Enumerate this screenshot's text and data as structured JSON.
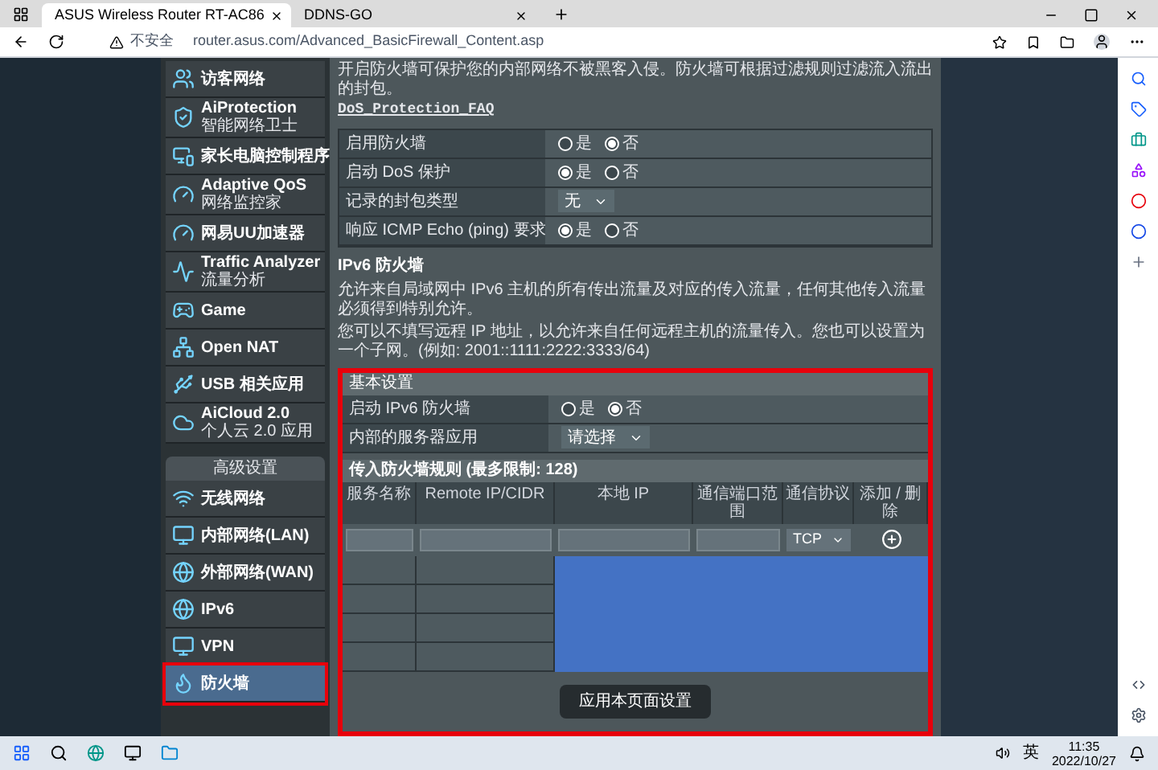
{
  "browser": {
    "tabs": [
      {
        "title": "ASUS Wireless Router RT-AC86",
        "selected": true
      },
      {
        "title": "DDNS-GO",
        "selected": false
      }
    ],
    "address": {
      "security_label": "不安全",
      "url": "router.asus.com/Advanced_BasicFirewall_Content.asp"
    }
  },
  "sidebar": {
    "general_items": [
      {
        "title": "访客网络",
        "selected": false
      },
      {
        "title": "AiProtection",
        "subtitle": "智能网络卫士",
        "selected": false
      },
      {
        "title": "家长电脑控制程序",
        "selected": false
      },
      {
        "title": "Adaptive QoS",
        "subtitle": "网络监控家",
        "selected": false
      },
      {
        "title": "网易UU加速器",
        "selected": false
      },
      {
        "title": "Traffic Analyzer",
        "subtitle": "流量分析",
        "selected": false
      },
      {
        "title": "Game",
        "selected": false
      },
      {
        "title": "Open NAT",
        "selected": false
      },
      {
        "title": "USB 相关应用",
        "selected": false
      },
      {
        "title": "AiCloud 2.0",
        "subtitle": "个人云 2.0 应用",
        "selected": false
      }
    ],
    "advanced_header": "高级设置",
    "advanced_items": [
      {
        "title": "无线网络",
        "selected": false
      },
      {
        "title": "内部网络(LAN)",
        "selected": false
      },
      {
        "title": "外部网络(WAN)",
        "selected": false
      },
      {
        "title": "IPv6",
        "selected": false
      },
      {
        "title": "VPN",
        "selected": false
      },
      {
        "title": "防火墙",
        "selected": true
      }
    ]
  },
  "main": {
    "intro": "开启防火墙可保护您的内部网络不被黑客入侵。防火墙可根据过滤规则过滤流入流出的封包。",
    "faq_link": "DoS_Protection_FAQ",
    "settings": [
      {
        "kind": "radio",
        "label": "启用防火墙",
        "options": [
          {
            "label": "是",
            "selected": false
          },
          {
            "label": "否",
            "selected": true
          }
        ]
      },
      {
        "kind": "radio",
        "label": "启动 DoS 保护",
        "options": [
          {
            "label": "是",
            "selected": true
          },
          {
            "label": "否",
            "selected": false
          }
        ]
      },
      {
        "kind": "select",
        "label": "记录的封包类型",
        "value": "无"
      },
      {
        "kind": "radio",
        "label": "响应 ICMP Echo (ping) 要求",
        "options": [
          {
            "label": "是",
            "selected": true
          },
          {
            "label": "否",
            "selected": false
          }
        ]
      }
    ],
    "ipv6_heading": "IPv6 防火墙",
    "ipv6_paragraphs": [
      "允许来自局域网中 IPv6 主机的所有传出流量及对应的传入流量，任何其他传入流量必须得到特别允许。",
      "您可以不填写远程 IP 地址，以允许来自任何远程主机的流量传入。您也可以设置为一个子网。(例如: 2001::1111:2222:3333/64)"
    ],
    "basic_header": "基本设置",
    "basic_settings": [
      {
        "kind": "radio",
        "label": "启动 IPv6 防火墙",
        "options": [
          {
            "label": "是",
            "selected": false
          },
          {
            "label": "否",
            "selected": true
          }
        ]
      },
      {
        "kind": "select",
        "label": "内部的服务器应用",
        "value": "请选择"
      }
    ],
    "rules_header": "传入防火墙规则 (最多限制: 128)",
    "rules_columns": [
      "服务名称",
      "Remote IP/CIDR",
      "本地 IP",
      "通信端口范围",
      "通信协议",
      "添加 / 删除"
    ],
    "protocol_value": "TCP",
    "apply_button": "应用本页面设置"
  },
  "taskbar": {
    "ime": "英",
    "time": "11:35",
    "date": "2022/10/27"
  }
}
